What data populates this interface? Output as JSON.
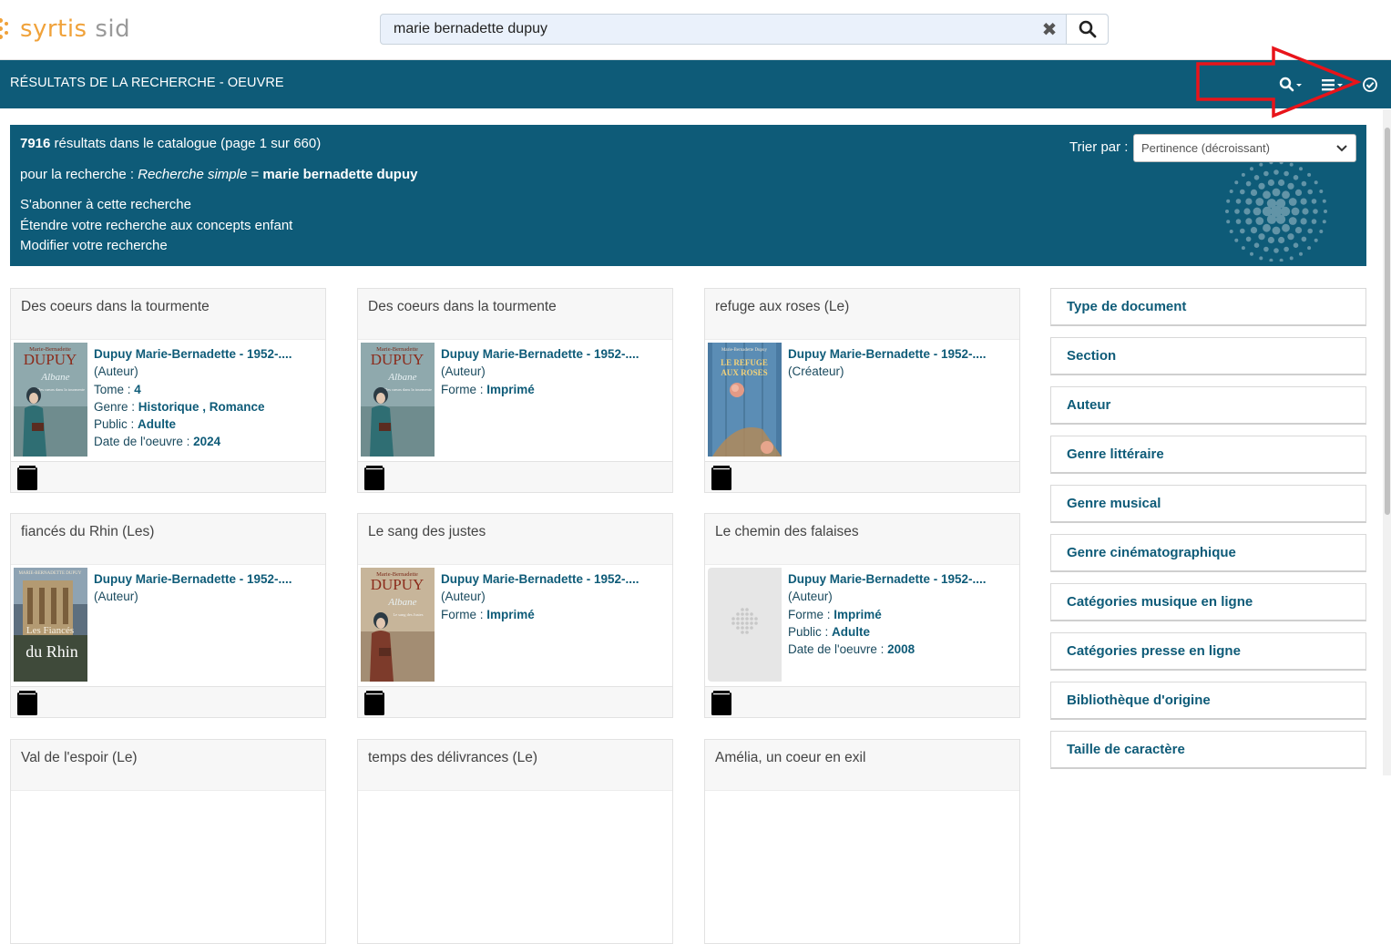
{
  "logo": {
    "part1": "syrtis",
    "part2": "sid"
  },
  "search": {
    "value": "marie bernadette dupuy",
    "clear_glyph": "✖"
  },
  "header": {
    "title": "RÉSULTATS DE LA RECHERCHE - OEUVRE",
    "icons": [
      "search-dropdown-icon",
      "list-menu-icon",
      "check-circle-icon"
    ]
  },
  "info": {
    "count": "7916",
    "count_text": " résultats dans le catalogue (page 1 sur 660)",
    "query_prefix": "pour la recherche : ",
    "query_type": "Recherche simple",
    "query_eq": " = ",
    "query_value": "marie bernadette dupuy",
    "subscribe": "S'abonner à cette recherche",
    "extend": "Étendre votre recherche aux concepts enfant",
    "modify": "Modifier votre recherche",
    "sort_label": "Trier par :",
    "sort_value": "Pertinence (décroissant)"
  },
  "cards": [
    {
      "title": "Des coeurs dans la tourmente",
      "author": "Dupuy Marie-Bernadette - 1952-....",
      "role": "(Auteur)",
      "fields": [
        {
          "k": "Tome : ",
          "v": "4"
        },
        {
          "k": "Genre : ",
          "v": "Historique , Romance"
        },
        {
          "k": "Public : ",
          "v": "Adulte"
        },
        {
          "k": "Date de l'oeuvre : ",
          "v": "2024"
        }
      ],
      "cover": "albane1"
    },
    {
      "title": "Des coeurs dans la tourmente",
      "author": "Dupuy Marie-Bernadette - 1952-....",
      "role": "(Auteur)",
      "fields": [
        {
          "k": "Forme : ",
          "v": "Imprimé"
        }
      ],
      "cover": "albane1"
    },
    {
      "title": "refuge aux roses (Le)",
      "author": "Dupuy Marie-Bernadette - 1952-....",
      "role": "(Créateur)",
      "fields": [],
      "cover": "refuge"
    },
    {
      "title": "fiancés du Rhin (Les)",
      "author": "Dupuy Marie-Bernadette - 1952-....",
      "role": "(Auteur)",
      "fields": [],
      "cover": "rhin"
    },
    {
      "title": "Le sang des justes",
      "author": "Dupuy Marie-Bernadette - 1952-....",
      "role": "(Auteur)",
      "fields": [
        {
          "k": "Forme : ",
          "v": "Imprimé"
        }
      ],
      "cover": "albane2"
    },
    {
      "title": "Le chemin des falaises",
      "author": "Dupuy Marie-Bernadette - 1952-....",
      "role": "(Auteur)",
      "fields": [
        {
          "k": "Forme : ",
          "v": "Imprimé"
        },
        {
          "k": "Public : ",
          "v": "Adulte"
        },
        {
          "k": "Date de l'oeuvre : ",
          "v": "2008"
        }
      ],
      "cover": "placeholder"
    },
    {
      "title": "Val de l'espoir (Le)"
    },
    {
      "title": "temps des délivrances (Le)"
    },
    {
      "title": "Amélia, un coeur en exil"
    }
  ],
  "cover_text": {
    "albane_name": "Marie-Bernadette",
    "albane_surname": "DUPUY",
    "albane_series": "Albane",
    "albane1_subtitle": "Des cœurs dans la tourmente",
    "albane2_subtitle": "Le sang des Justes",
    "refuge_author": "Marie-Bernadette Dupuy",
    "refuge_title1": "LE REFUGE",
    "refuge_title2": "AUX ROSES",
    "rhin_author": "MARIE-BERNADETTE DUPUY",
    "rhin_title1": "Les Fiancés",
    "rhin_title2": "du Rhin"
  },
  "facets": [
    "Type de document",
    "Section",
    "Auteur",
    "Genre littéraire",
    "Genre musical",
    "Genre cinématographique",
    "Catégories musique en ligne",
    "Catégories presse en ligne",
    "Bibliothèque d'origine",
    "Taille de caractère"
  ],
  "colors": {
    "brand": "#0e5b78",
    "logo_orange": "#f0a23a",
    "annotation_red": "#e8141a"
  }
}
